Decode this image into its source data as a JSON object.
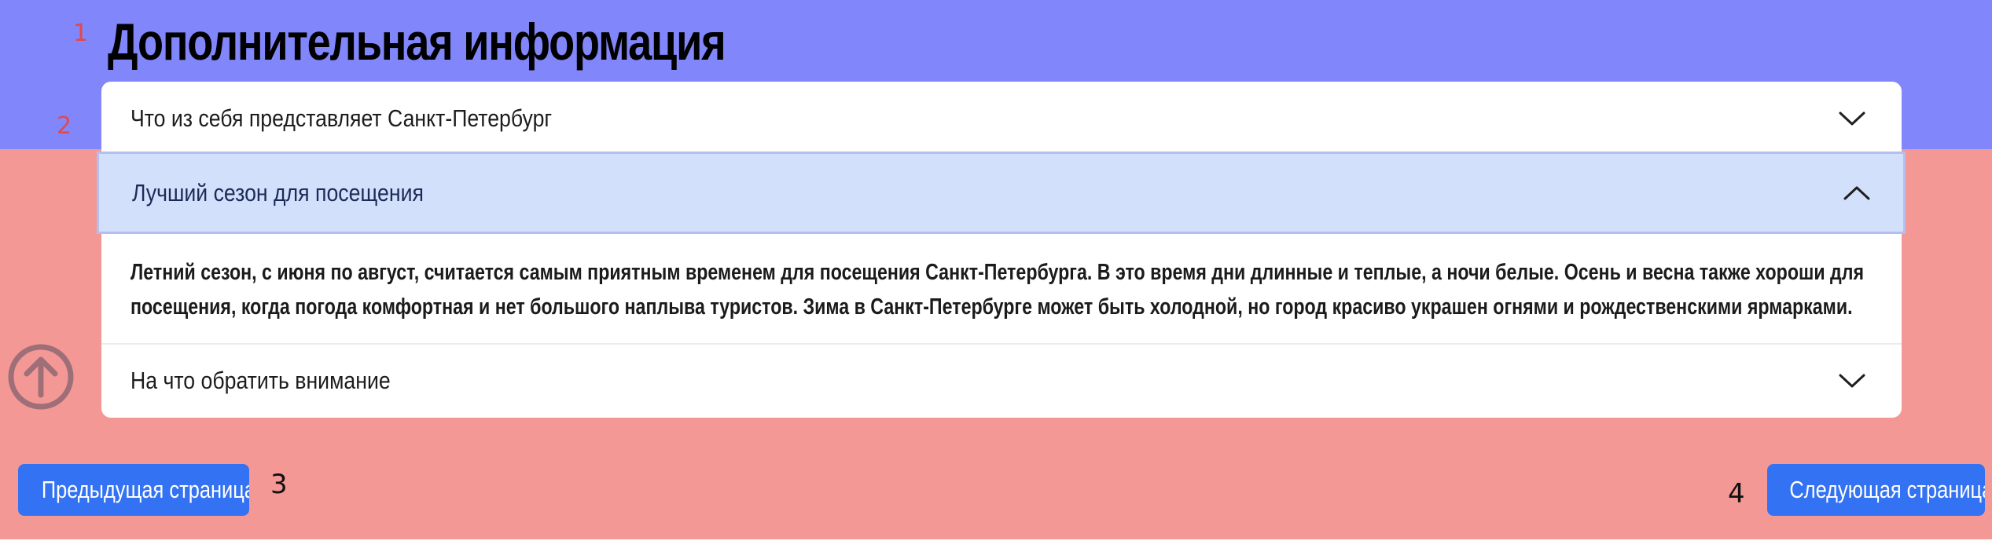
{
  "markers": [
    "1",
    "2",
    "3",
    "4"
  ],
  "page_title": "Дополнительная информация",
  "accordion": {
    "items": [
      {
        "question": "Что из себя представляет Санкт-Петербург",
        "expanded": false
      },
      {
        "question": "Лучший сезон для посещения",
        "expanded": true,
        "answer_lines": [
          "Летний сезон, с июня по август, считается самым приятным временем для посещения Санкт-Петербурга. В это время дни длинные и теплые, а ночи белые. Осень и весна также хороши для",
          "посещения, когда погода комфортная и нет большого наплыва туристов. Зима в Санкт-Петербурге может быть холодной, но город красиво украшен огнями и рождественскими ярмарками."
        ]
      },
      {
        "question": "На что обратить внимание",
        "expanded": false
      }
    ]
  },
  "icons": {
    "expand": "chevron-down-icon",
    "collapse": "chevron-up-icon",
    "scroll_top": "arrow-up-circle-icon"
  },
  "navigation": {
    "prev_label": "Предыдущая страница",
    "next_label": "Следующая страница"
  },
  "colors": {
    "top_band": "#8186fb",
    "bottom_band": "#f49896",
    "active_header": "#d3e0fb",
    "button": "#3372f2",
    "marker_red": "#e2484c"
  }
}
